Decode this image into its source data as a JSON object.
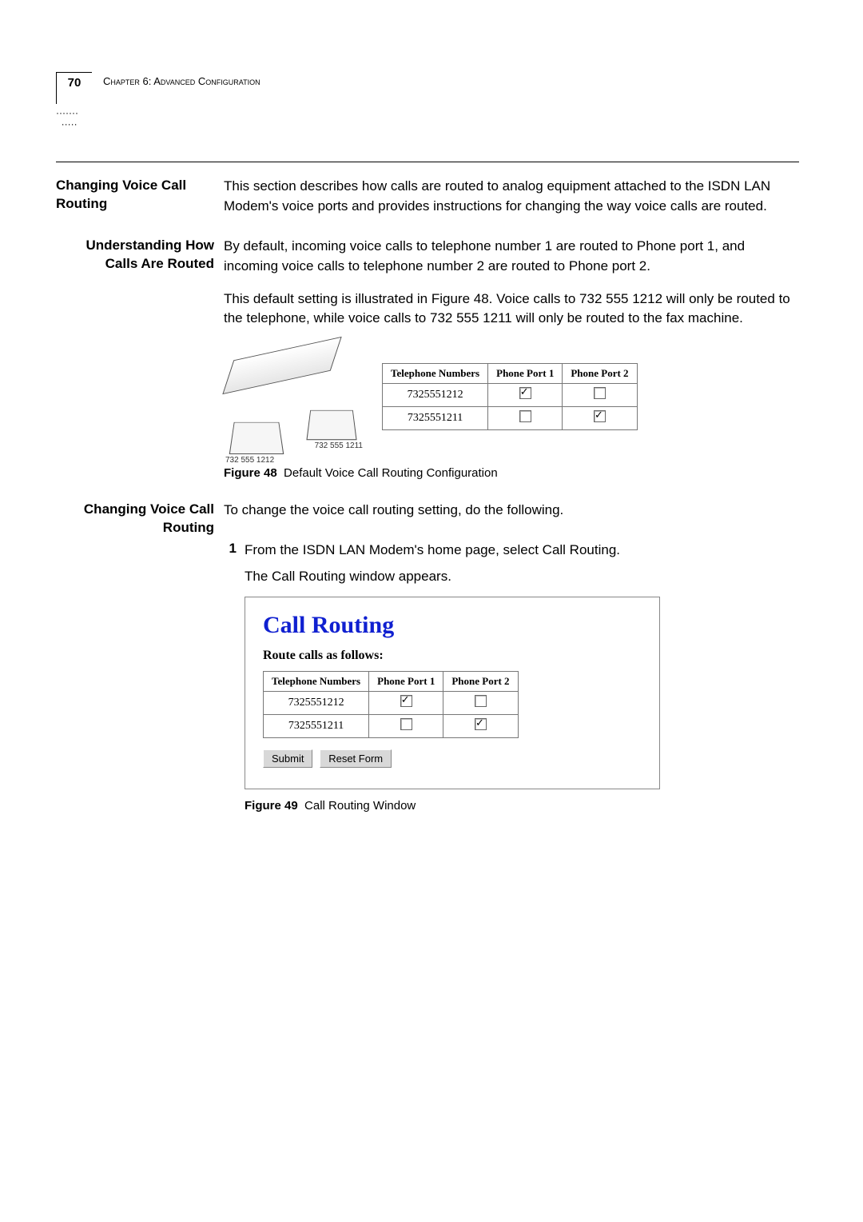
{
  "header": {
    "page_number": "70",
    "chapter_label": "Chapter 6: Advanced Configuration"
  },
  "section1": {
    "title": "Changing Voice Call Routing",
    "body": "This section describes how calls are routed to analog equipment attached to the ISDN LAN Modem's voice ports and provides instructions for changing the way voice calls are routed."
  },
  "section2": {
    "title": "Understanding How Calls Are Routed",
    "body1": "By default, incoming voice calls to telephone number 1 are routed to Phone port 1, and incoming voice calls to telephone number 2 are routed to Phone port 2.",
    "body2": "This default setting is illustrated in Figure 48. Voice calls to 732 555 1212 will only be routed to the telephone, while voice calls to 732 555 1211 will only be routed to the fax machine."
  },
  "illustration": {
    "phone_label": "732 555 1212",
    "fax_label": "732 555 1211",
    "table": {
      "headers": [
        "Telephone Numbers",
        "Phone Port 1",
        "Phone Port 2"
      ],
      "rows": [
        {
          "num": "7325551212",
          "p1": true,
          "p2": false
        },
        {
          "num": "7325551211",
          "p1": false,
          "p2": true
        }
      ]
    }
  },
  "fig48": {
    "label": "Figure 48",
    "caption": "Default Voice Call Routing Configuration"
  },
  "section3": {
    "title": "Changing Voice Call Routing",
    "body": "To change the voice call routing setting, do the following."
  },
  "step1": {
    "num": "1",
    "text1": "From the ISDN LAN Modem's home page, select Call Routing.",
    "text2": "The Call Routing window appears."
  },
  "cr_window": {
    "title": "Call Routing",
    "subtitle": "Route calls as follows:",
    "table": {
      "headers": [
        "Telephone Numbers",
        "Phone Port 1",
        "Phone Port 2"
      ],
      "rows": [
        {
          "num": "7325551212",
          "p1": true,
          "p2": false
        },
        {
          "num": "7325551211",
          "p1": false,
          "p2": true
        }
      ]
    },
    "btn_submit": "Submit",
    "btn_reset": "Reset Form"
  },
  "fig49": {
    "label": "Figure 49",
    "caption": "Call Routing Window"
  }
}
